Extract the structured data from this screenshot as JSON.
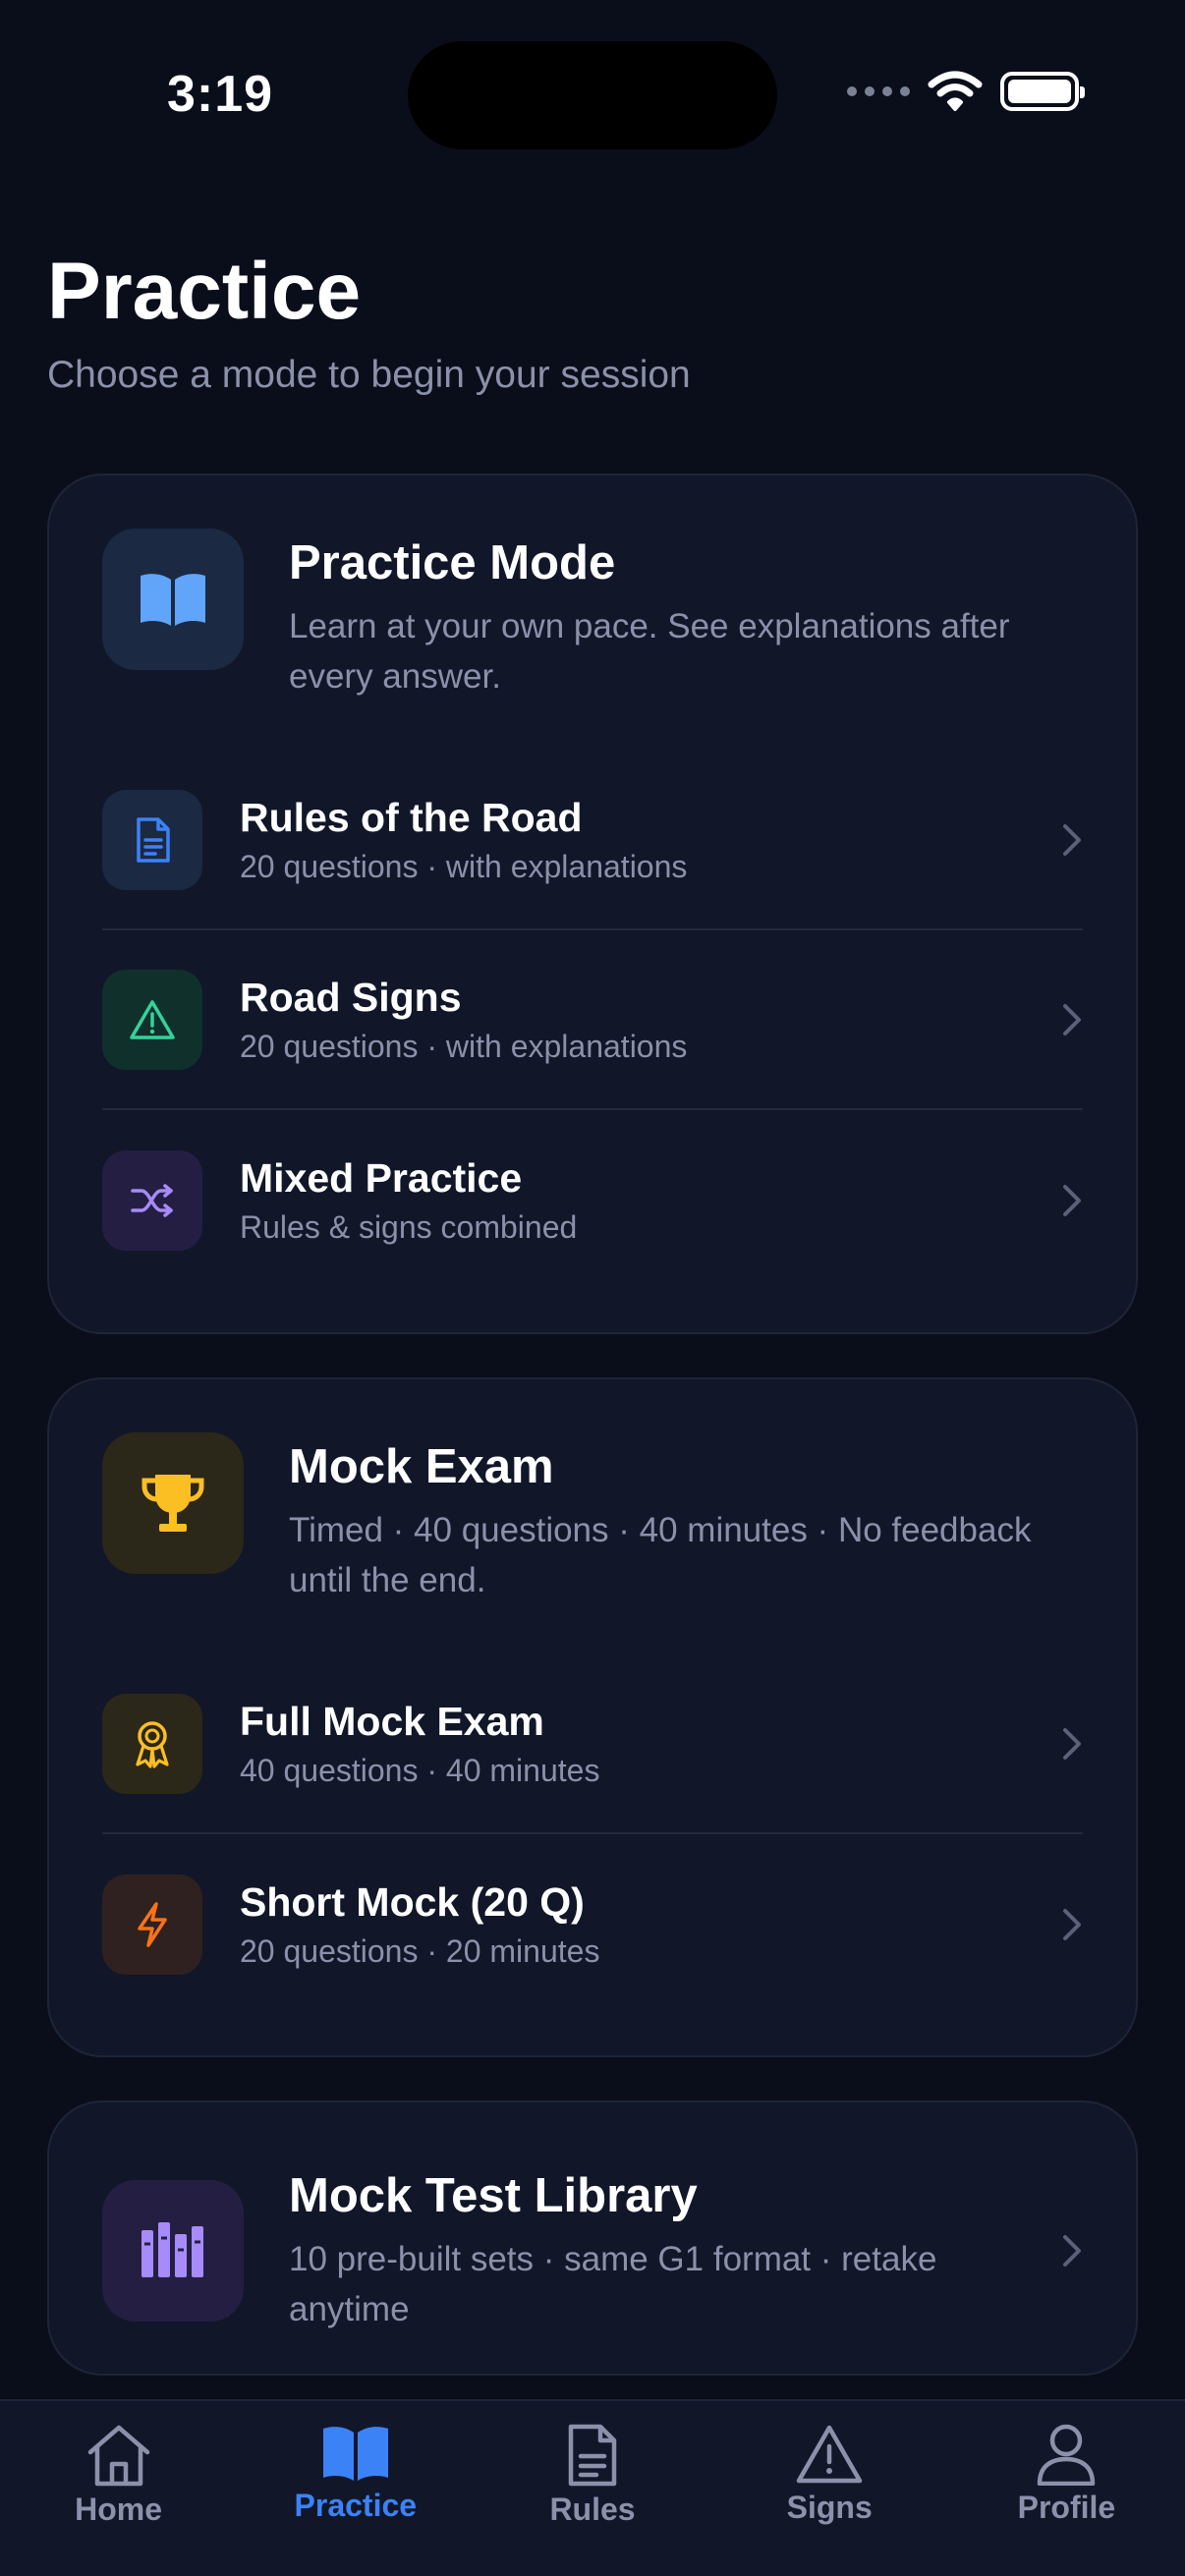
{
  "status_bar": {
    "time": "3:19"
  },
  "header": {
    "title": "Practice",
    "subtitle": "Choose a mode to begin your session"
  },
  "practice_mode": {
    "title": "Practice Mode",
    "description": "Learn at your own pace. See explanations after every answer.",
    "icon": "open-book-icon",
    "items": [
      {
        "title": "Rules of the Road",
        "subtitle": "20 questions · with explanations",
        "icon": "document-icon",
        "color": "#3b82f6"
      },
      {
        "title": "Road Signs",
        "subtitle": "20 questions · with explanations",
        "icon": "warning-triangle-icon",
        "color": "#34d399"
      },
      {
        "title": "Mixed Practice",
        "subtitle": "Rules & signs combined",
        "icon": "shuffle-icon",
        "color": "#a78bfa"
      }
    ]
  },
  "mock_exam": {
    "title": "Mock Exam",
    "description": "Timed · 40 questions · 40 minutes · No feedback until the end.",
    "icon": "trophy-icon",
    "items": [
      {
        "title": "Full Mock Exam",
        "subtitle": "40 questions · 40 minutes",
        "icon": "award-ribbon-icon",
        "color": "#fbbf24"
      },
      {
        "title": "Short Mock (20 Q)",
        "subtitle": "20 questions · 20 minutes",
        "icon": "lightning-icon",
        "color": "#f97316"
      }
    ]
  },
  "library": {
    "title": "Mock Test Library",
    "description": "10 pre-built sets · same G1 format · retake anytime",
    "icon": "library-books-icon"
  },
  "tabs": [
    {
      "label": "Home",
      "icon": "home-icon",
      "active": false
    },
    {
      "label": "Practice",
      "icon": "open-book-icon",
      "active": true
    },
    {
      "label": "Rules",
      "icon": "document-icon",
      "active": false
    },
    {
      "label": "Signs",
      "icon": "warning-triangle-icon",
      "active": false
    },
    {
      "label": "Profile",
      "icon": "user-icon",
      "active": false
    }
  ],
  "colors": {
    "background": "#0a0e1a",
    "card": "#111729",
    "accent": "#3b82f6",
    "muted_text": "#8b91aa"
  }
}
